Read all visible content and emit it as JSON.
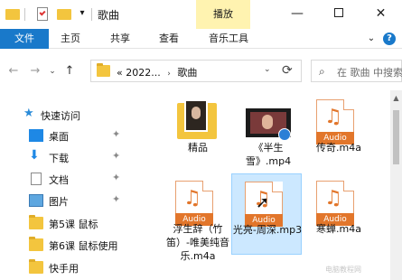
{
  "titlebar": {
    "title": "歌曲",
    "context_tab_header": "播放",
    "quick_dropdown": "▾",
    "minimize": "—",
    "close": "✕"
  },
  "ribbon": {
    "tabs": [
      {
        "label": "文件"
      },
      {
        "label": "主页"
      },
      {
        "label": "共享"
      },
      {
        "label": "查看"
      },
      {
        "label": "音乐工具"
      }
    ],
    "collapse": "⌄",
    "help": "?"
  },
  "address": {
    "back": "←",
    "forward": "→",
    "recent": "⌄",
    "up": "↑",
    "overflow": "«",
    "crumbs": [
      "2022...",
      "歌曲"
    ],
    "crumb_sep": "›",
    "dropdown": "⌄",
    "refresh": "⟳"
  },
  "search": {
    "placeholder": "在 歌曲 中搜索",
    "icon": "search-icon"
  },
  "navpane": {
    "quick_access": "快速访问",
    "items": [
      {
        "label": "桌面",
        "pinned": true,
        "icon": "desktop-icon"
      },
      {
        "label": "下载",
        "pinned": true,
        "icon": "download-icon"
      },
      {
        "label": "文档",
        "pinned": true,
        "icon": "document-icon"
      },
      {
        "label": "图片",
        "pinned": true,
        "icon": "pictures-icon"
      },
      {
        "label": "第5课 鼠标",
        "pinned": false,
        "icon": "folder-icon"
      },
      {
        "label": "第6课 鼠标使用",
        "pinned": false,
        "icon": "folder-icon"
      },
      {
        "label": "快手用",
        "pinned": false,
        "icon": "folder-icon"
      }
    ],
    "pin_glyph": "📌"
  },
  "files": [
    {
      "name": "精品",
      "type": "folder"
    },
    {
      "name": "《半生雪》.mp4",
      "type": "video"
    },
    {
      "name": "传奇.m4a",
      "type": "audio"
    },
    {
      "name": "浮生辞（竹笛）-唯美纯音乐.m4a",
      "type": "audio"
    },
    {
      "name": "光亮-周深.mp3",
      "type": "audio",
      "selected": true
    },
    {
      "name": "寒蝉.m4a",
      "type": "audio"
    }
  ],
  "audio_label": "Audio",
  "watermark": "电脑教程网"
}
